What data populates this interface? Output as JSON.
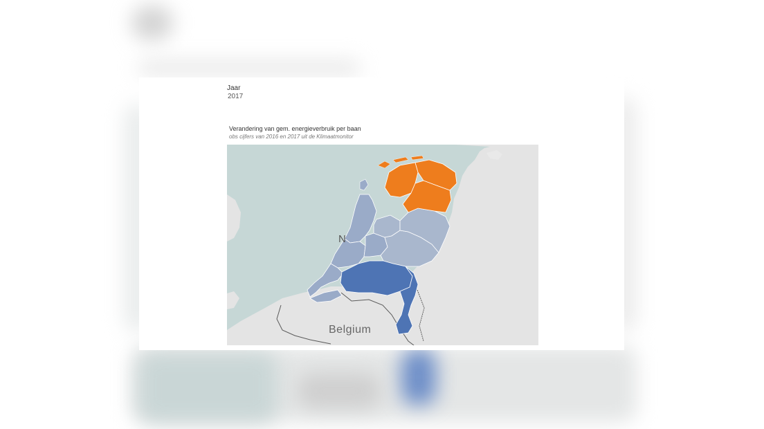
{
  "filter": {
    "label": "Jaar",
    "value": "2017"
  },
  "chart": {
    "title": "Verandering van gem. energieverbruik per baan",
    "subtitle": "obs cijfers van 2016 en 2017 uit de Klimaatmonitor"
  },
  "map": {
    "country_label": "Belgium",
    "partial_label": "N",
    "colors": {
      "sea": "#c6d7d6",
      "land": "#e4e4e4",
      "land_light": "#ececec",
      "region_light": "#a9b7cd",
      "region_mid": "#9aabc8",
      "region_dark": "#4e74b4",
      "region_orange": "#ee7d1d",
      "border": "#5a5a5a"
    }
  }
}
